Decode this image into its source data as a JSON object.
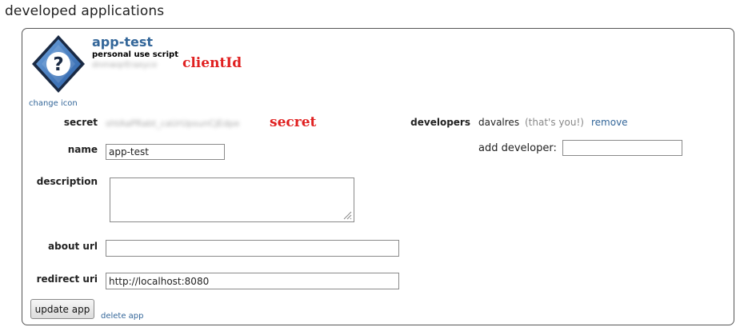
{
  "page": {
    "heading": "developed applications"
  },
  "app": {
    "name": "app-test",
    "type": "personal use script",
    "client_id": "dnmwqrEraeyce",
    "change_icon_label": "change icon",
    "icon": "question-mark-diamond-icon"
  },
  "annotations": {
    "client_id": "clientId",
    "secret": "secret"
  },
  "form": {
    "secret_label": "secret",
    "secret_value": "shtAaPRabt_caUrUpsunCjEdpe",
    "name_label": "name",
    "name_value": "app-test",
    "description_label": "description",
    "description_value": "",
    "about_url_label": "about url",
    "about_url_value": "",
    "redirect_uri_label": "redirect uri",
    "redirect_uri_value": "http://localhost:8080"
  },
  "developers": {
    "label": "developers",
    "name": "davalres",
    "you_note": "(that's you!)",
    "remove_label": "remove",
    "add_label": "add developer:",
    "add_value": ""
  },
  "actions": {
    "update_label": "update app",
    "delete_label": "delete app"
  },
  "colors": {
    "link": "#336699",
    "annotation": "#e02020",
    "border": "#555555"
  }
}
